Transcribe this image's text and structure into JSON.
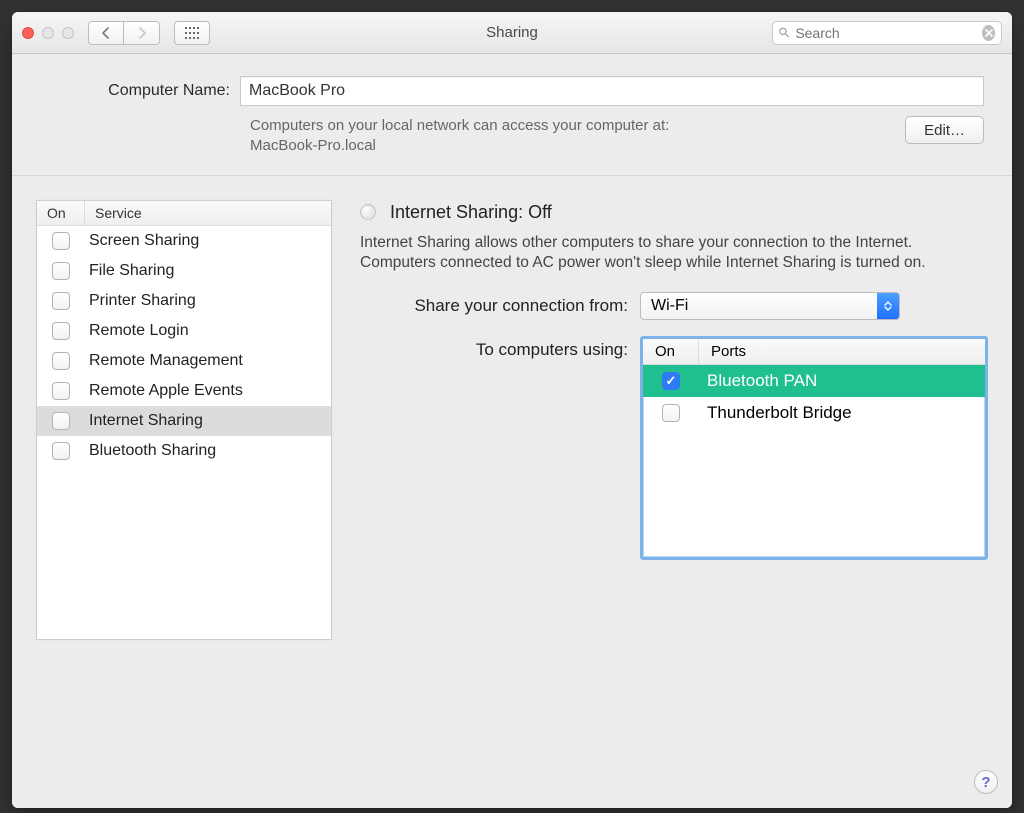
{
  "window": {
    "title": "Sharing"
  },
  "search": {
    "placeholder": "Search"
  },
  "computer_name": {
    "label": "Computer Name:",
    "value": "MacBook Pro",
    "subtext_1": "Computers on your local network can access your computer at:",
    "subtext_2": "MacBook-Pro.local",
    "edit_label": "Edit…"
  },
  "services": {
    "header_on": "On",
    "header_service": "Service",
    "items": [
      {
        "label": "Screen Sharing",
        "on": false,
        "selected": false
      },
      {
        "label": "File Sharing",
        "on": false,
        "selected": false
      },
      {
        "label": "Printer Sharing",
        "on": false,
        "selected": false
      },
      {
        "label": "Remote Login",
        "on": false,
        "selected": false
      },
      {
        "label": "Remote Management",
        "on": false,
        "selected": false
      },
      {
        "label": "Remote Apple Events",
        "on": false,
        "selected": false
      },
      {
        "label": "Internet Sharing",
        "on": false,
        "selected": true
      },
      {
        "label": "Bluetooth Sharing",
        "on": false,
        "selected": false
      }
    ]
  },
  "detail": {
    "status_title": "Internet Sharing: Off",
    "description": "Internet Sharing allows other computers to share your connection to the Internet. Computers connected to AC power won't sleep while Internet Sharing is turned on.",
    "share_from_label": "Share your connection from:",
    "share_from_value": "Wi-Fi",
    "to_using_label": "To computers using:",
    "ports_header_on": "On",
    "ports_header_ports": "Ports",
    "ports": [
      {
        "label": "Bluetooth PAN",
        "on": true,
        "active": true
      },
      {
        "label": "Thunderbolt Bridge",
        "on": false,
        "active": false
      }
    ]
  },
  "help_label": "?"
}
